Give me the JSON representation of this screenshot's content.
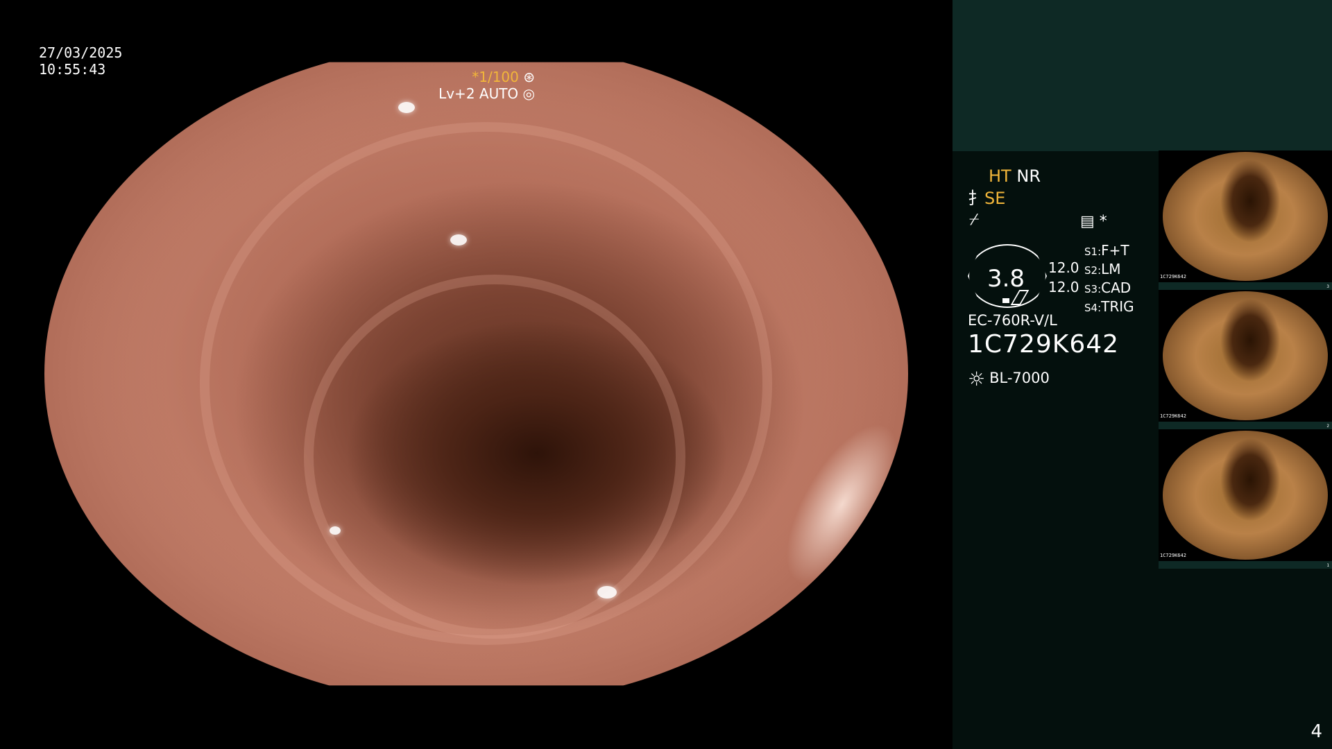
{
  "overlay": {
    "date": "27/03/2025",
    "time": "10:55:43",
    "shutter": "*1/100",
    "shutter_icon": "aperture-icon",
    "level": "Lv+2 AUTO",
    "auto_icon": "iris-icon"
  },
  "panel": {
    "ht": "HT",
    "nr": "NR",
    "se_prefix": "⺘",
    "se": "SE",
    "enh": "⌿",
    "settings_icon": "settings-sheet-icon",
    "star": "*",
    "gauge_value": "3.8",
    "gauge_values": [
      "12.0",
      "12.0"
    ],
    "switches": [
      {
        "key": "S1:",
        "value": "F+T"
      },
      {
        "key": "S2:",
        "value": "LM"
      },
      {
        "key": "S3:",
        "value": "CAD"
      },
      {
        "key": "S4:",
        "value": "TRIG"
      }
    ],
    "model": "EC-760R-V/L",
    "serial": "1C729K642",
    "light_source_icon": "light-source-icon",
    "light_source": "BL-7000"
  },
  "thumbnails": [
    {
      "tag": "1C729K642",
      "number": "3"
    },
    {
      "tag": "1C729K642",
      "number": "2"
    },
    {
      "tag": "1C729K642",
      "number": "1"
    }
  ],
  "page_number": "4"
}
